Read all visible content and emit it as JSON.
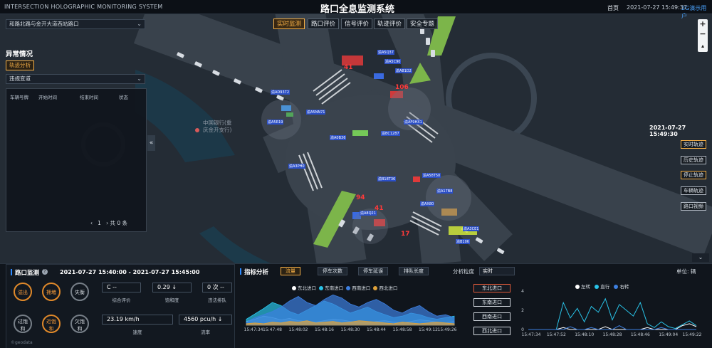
{
  "header": {
    "system_en": "INTERSECTION HOLOGRAPHIC MONITORING SYSTEM",
    "system_cn": "路口全息监测系统",
    "home_link": "首页",
    "clock": "2021-07-27 15:49:37",
    "user_link": "2G演示用户"
  },
  "tabs": [
    "实时监测",
    "路口评价",
    "信号评价",
    "轨迹评价",
    "安全专题"
  ],
  "left_panel": {
    "intersection": "和路北路与金开大道西站路口",
    "anomaly_title": "异常情况",
    "track_button": "轨迹分析",
    "violation_type": "违规变道",
    "table_headers": [
      "车辆号牌",
      "开始时间",
      "结束时间",
      "状态"
    ],
    "pager": {
      "prev": "‹",
      "page": "1",
      "next": "›",
      "total": "共 0 条"
    }
  },
  "map": {
    "poi": "中国银行(重庆金开支行)",
    "timestamp": "2021-07-27 15:49:30",
    "side_buttons": [
      "实时轨迹",
      "历史轨迹",
      "停止轨迹",
      "车辆轨迹",
      "路口视频"
    ],
    "counts": [
      {
        "label": "41"
      },
      {
        "label": "106"
      },
      {
        "label": "94"
      },
      {
        "label": "41"
      },
      {
        "label": "17"
      }
    ],
    "plates": [
      "渝A5NN71",
      "渝A0B36",
      "渝BC1287",
      "渝A3PH0",
      "渝B18T36",
      "渝AF9HX1",
      "渝A5Q37",
      "渝A81D2",
      "渝AD9372",
      "渝A5R19",
      "渝A58T50",
      "渝A17B8",
      "渝AX80",
      "渝A8Q21",
      "渝A3CE1",
      "渝B106",
      "渝A5C90"
    ]
  },
  "bottom_left": {
    "title": "路口监测",
    "time_range": "2021-07-27 15:40:00 - 2021-07-27 15:45:00",
    "status_circles": [
      {
        "label": "溢出",
        "style": "orange"
      },
      {
        "label": "拥堵",
        "style": "orange"
      },
      {
        "label": "失衡",
        "style": "gray"
      },
      {
        "label": "过饱和",
        "style": "gray"
      },
      {
        "label": "近饱和",
        "style": "orange"
      },
      {
        "label": "欠饱和",
        "style": "gray"
      }
    ],
    "metrics": [
      {
        "value": "C --",
        "label": "综合评价"
      },
      {
        "value": "0.29 ↓",
        "label": "饱和度"
      },
      {
        "value": "0 次 --",
        "label": "违法排队"
      },
      {
        "value": "23.19 km/h",
        "label": "速度"
      },
      {
        "value": "4560 pcu/h ↓",
        "label": "流率"
      }
    ],
    "footer": "©geodata"
  },
  "bottom_mid": {
    "title": "指标分析",
    "metric_tabs": [
      "流量",
      "停车次数",
      "停车延误",
      "排队长度"
    ],
    "granularity_label": "分析粒度",
    "granularity_value": "实时"
  },
  "bottom_right": {
    "unit": "单位: 辆",
    "directions": [
      "东北进口",
      "东南进口",
      "西南进口",
      "西北进口"
    ]
  },
  "chart_data": [
    {
      "type": "area",
      "title": "",
      "legend": [
        "东北进口",
        "东南进口",
        "西南进口",
        "西北进口"
      ],
      "colors": [
        "#ffffff",
        "#29c3e8",
        "#3d7fe0",
        "#e0a23a"
      ],
      "x": [
        "15:47:34",
        "15:47:48",
        "15:48:02",
        "15:48:16",
        "15:48:30",
        "15:48:44",
        "15:48:58",
        "15:49:12",
        "15:49:26"
      ],
      "series": [
        {
          "name": "东北进口",
          "values": [
            5,
            8,
            12,
            10,
            7,
            9,
            6,
            5,
            4,
            6,
            8,
            7,
            5,
            4,
            3,
            5,
            6,
            4,
            3,
            5,
            7,
            6,
            4,
            3,
            5
          ]
        },
        {
          "name": "东南进口",
          "values": [
            8,
            15,
            22,
            30,
            26,
            18,
            14,
            20,
            26,
            32,
            28,
            22,
            16,
            20,
            24,
            18,
            14,
            10,
            12,
            16,
            14,
            10,
            8,
            10,
            12
          ]
        },
        {
          "name": "西南进口",
          "values": [
            4,
            10,
            14,
            18,
            24,
            32,
            38,
            30,
            26,
            34,
            40,
            36,
            28,
            24,
            30,
            34,
            28,
            20,
            16,
            22,
            26,
            18,
            12,
            14,
            10
          ]
        },
        {
          "name": "西北进口",
          "values": [
            2,
            3,
            2,
            4,
            3,
            5,
            4,
            6,
            3,
            4,
            5,
            3,
            4,
            6,
            5,
            4,
            3,
            2,
            4,
            3,
            2,
            3,
            4,
            3,
            2
          ]
        }
      ]
    },
    {
      "type": "line",
      "title": "",
      "legend": [
        "左转",
        "直行",
        "右转"
      ],
      "colors": [
        "#ffffff",
        "#29c3e8",
        "#3d7fe0"
      ],
      "ylim": [
        0,
        4
      ],
      "yticks": [
        0,
        2,
        4
      ],
      "x": [
        "15:47:34",
        "15:47:52",
        "15:48:10",
        "15:48:28",
        "15:48:46",
        "15:49:04",
        "15:49:22"
      ],
      "series": [
        {
          "name": "左转",
          "values": [
            0,
            0,
            0,
            0,
            0,
            0.2,
            0,
            0,
            0,
            0,
            0,
            0.3,
            0,
            0,
            0,
            0,
            0,
            0.2,
            0,
            0,
            0,
            0,
            0.4,
            0.6,
            0.3
          ]
        },
        {
          "name": "直行",
          "values": [
            0,
            0,
            0,
            0,
            0,
            2.8,
            1.2,
            2.2,
            0.8,
            2.4,
            1.8,
            3.2,
            1.0,
            2.6,
            2.0,
            1.4,
            2.8,
            0.6,
            0.2,
            0.8,
            0.3,
            0.1,
            0.5,
            0.9,
            0.4
          ]
        },
        {
          "name": "右转",
          "values": [
            0,
            0,
            0,
            0,
            0,
            0,
            0.3,
            0,
            0,
            0.2,
            0,
            0,
            0,
            0.4,
            0,
            0,
            0,
            0,
            0,
            0.2,
            0,
            0,
            0,
            0,
            0
          ]
        }
      ]
    }
  ]
}
